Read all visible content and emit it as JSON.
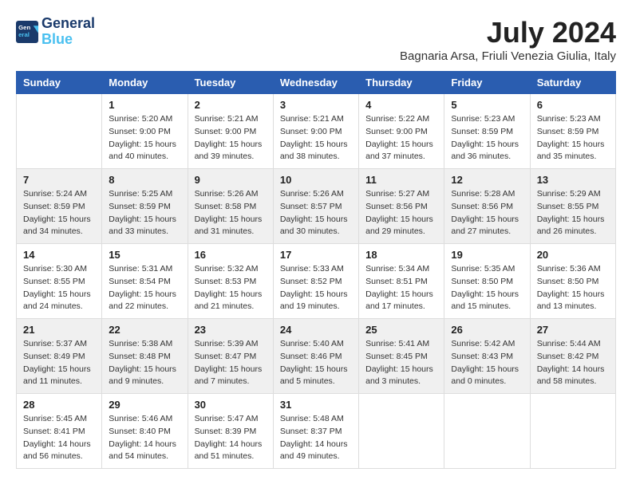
{
  "header": {
    "logo_line1": "General",
    "logo_line2": "Blue",
    "month_year": "July 2024",
    "location": "Bagnaria Arsa, Friuli Venezia Giulia, Italy"
  },
  "calendar": {
    "weekdays": [
      "Sunday",
      "Monday",
      "Tuesday",
      "Wednesday",
      "Thursday",
      "Friday",
      "Saturday"
    ],
    "weeks": [
      [
        {
          "day": "",
          "info": ""
        },
        {
          "day": "1",
          "info": "Sunrise: 5:20 AM\nSunset: 9:00 PM\nDaylight: 15 hours\nand 40 minutes."
        },
        {
          "day": "2",
          "info": "Sunrise: 5:21 AM\nSunset: 9:00 PM\nDaylight: 15 hours\nand 39 minutes."
        },
        {
          "day": "3",
          "info": "Sunrise: 5:21 AM\nSunset: 9:00 PM\nDaylight: 15 hours\nand 38 minutes."
        },
        {
          "day": "4",
          "info": "Sunrise: 5:22 AM\nSunset: 9:00 PM\nDaylight: 15 hours\nand 37 minutes."
        },
        {
          "day": "5",
          "info": "Sunrise: 5:23 AM\nSunset: 8:59 PM\nDaylight: 15 hours\nand 36 minutes."
        },
        {
          "day": "6",
          "info": "Sunrise: 5:23 AM\nSunset: 8:59 PM\nDaylight: 15 hours\nand 35 minutes."
        }
      ],
      [
        {
          "day": "7",
          "info": "Sunrise: 5:24 AM\nSunset: 8:59 PM\nDaylight: 15 hours\nand 34 minutes."
        },
        {
          "day": "8",
          "info": "Sunrise: 5:25 AM\nSunset: 8:59 PM\nDaylight: 15 hours\nand 33 minutes."
        },
        {
          "day": "9",
          "info": "Sunrise: 5:26 AM\nSunset: 8:58 PM\nDaylight: 15 hours\nand 31 minutes."
        },
        {
          "day": "10",
          "info": "Sunrise: 5:26 AM\nSunset: 8:57 PM\nDaylight: 15 hours\nand 30 minutes."
        },
        {
          "day": "11",
          "info": "Sunrise: 5:27 AM\nSunset: 8:56 PM\nDaylight: 15 hours\nand 29 minutes."
        },
        {
          "day": "12",
          "info": "Sunrise: 5:28 AM\nSunset: 8:56 PM\nDaylight: 15 hours\nand 27 minutes."
        },
        {
          "day": "13",
          "info": "Sunrise: 5:29 AM\nSunset: 8:55 PM\nDaylight: 15 hours\nand 26 minutes."
        }
      ],
      [
        {
          "day": "14",
          "info": "Sunrise: 5:30 AM\nSunset: 8:55 PM\nDaylight: 15 hours\nand 24 minutes."
        },
        {
          "day": "15",
          "info": "Sunrise: 5:31 AM\nSunset: 8:54 PM\nDaylight: 15 hours\nand 22 minutes."
        },
        {
          "day": "16",
          "info": "Sunrise: 5:32 AM\nSunset: 8:53 PM\nDaylight: 15 hours\nand 21 minutes."
        },
        {
          "day": "17",
          "info": "Sunrise: 5:33 AM\nSunset: 8:52 PM\nDaylight: 15 hours\nand 19 minutes."
        },
        {
          "day": "18",
          "info": "Sunrise: 5:34 AM\nSunset: 8:51 PM\nDaylight: 15 hours\nand 17 minutes."
        },
        {
          "day": "19",
          "info": "Sunrise: 5:35 AM\nSunset: 8:50 PM\nDaylight: 15 hours\nand 15 minutes."
        },
        {
          "day": "20",
          "info": "Sunrise: 5:36 AM\nSunset: 8:50 PM\nDaylight: 15 hours\nand 13 minutes."
        }
      ],
      [
        {
          "day": "21",
          "info": "Sunrise: 5:37 AM\nSunset: 8:49 PM\nDaylight: 15 hours\nand 11 minutes."
        },
        {
          "day": "22",
          "info": "Sunrise: 5:38 AM\nSunset: 8:48 PM\nDaylight: 15 hours\nand 9 minutes."
        },
        {
          "day": "23",
          "info": "Sunrise: 5:39 AM\nSunset: 8:47 PM\nDaylight: 15 hours\nand 7 minutes."
        },
        {
          "day": "24",
          "info": "Sunrise: 5:40 AM\nSunset: 8:46 PM\nDaylight: 15 hours\nand 5 minutes."
        },
        {
          "day": "25",
          "info": "Sunrise: 5:41 AM\nSunset: 8:45 PM\nDaylight: 15 hours\nand 3 minutes."
        },
        {
          "day": "26",
          "info": "Sunrise: 5:42 AM\nSunset: 8:43 PM\nDaylight: 15 hours\nand 0 minutes."
        },
        {
          "day": "27",
          "info": "Sunrise: 5:44 AM\nSunset: 8:42 PM\nDaylight: 14 hours\nand 58 minutes."
        }
      ],
      [
        {
          "day": "28",
          "info": "Sunrise: 5:45 AM\nSunset: 8:41 PM\nDaylight: 14 hours\nand 56 minutes."
        },
        {
          "day": "29",
          "info": "Sunrise: 5:46 AM\nSunset: 8:40 PM\nDaylight: 14 hours\nand 54 minutes."
        },
        {
          "day": "30",
          "info": "Sunrise: 5:47 AM\nSunset: 8:39 PM\nDaylight: 14 hours\nand 51 minutes."
        },
        {
          "day": "31",
          "info": "Sunrise: 5:48 AM\nSunset: 8:37 PM\nDaylight: 14 hours\nand 49 minutes."
        },
        {
          "day": "",
          "info": ""
        },
        {
          "day": "",
          "info": ""
        },
        {
          "day": "",
          "info": ""
        }
      ]
    ]
  }
}
